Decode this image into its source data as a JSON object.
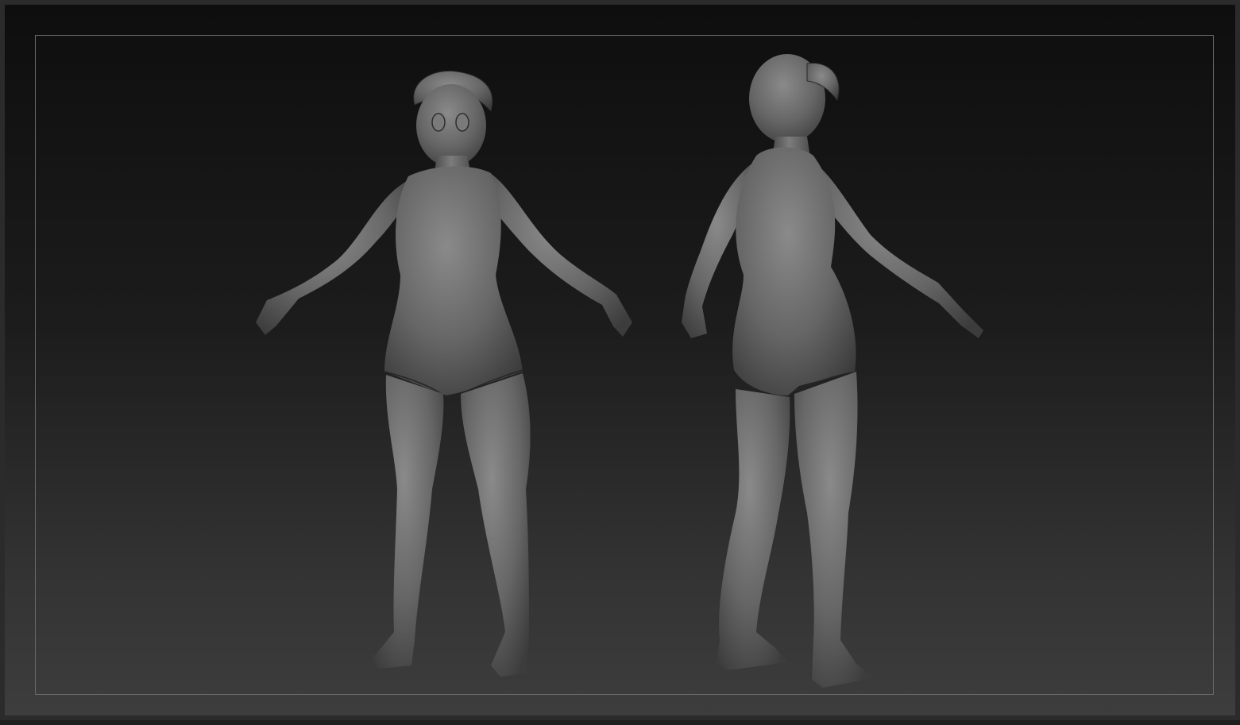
{
  "viewport": {
    "background_top": "#0e0e0e",
    "background_bottom": "#3d3d3d",
    "frame_color": "#6a6a6a"
  },
  "models": [
    {
      "name": "front-view-figure",
      "view": "front",
      "material_color": "#6b6b6b"
    },
    {
      "name": "back-view-figure",
      "view": "back",
      "material_color": "#6b6b6b"
    }
  ]
}
